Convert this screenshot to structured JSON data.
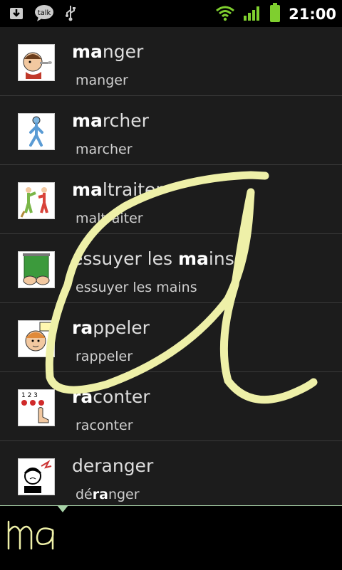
{
  "status_bar": {
    "time": "21:00",
    "talk_label": "talk",
    "icons": [
      "download-icon",
      "talk-icon",
      "usb-icon",
      "wifi-icon",
      "signal-icon",
      "battery-icon"
    ],
    "accent": "#7fcf2f"
  },
  "query": {
    "typed": "ma"
  },
  "list": {
    "items": [
      {
        "title_hl": "ma",
        "title_rest": "nger",
        "title_pre": "",
        "sub_pre": "manger",
        "sub_hl": "",
        "sub_post": "",
        "picto": "eating-icon"
      },
      {
        "title_hl": "ma",
        "title_rest": "rcher",
        "title_pre": "",
        "sub_pre": "marcher",
        "sub_hl": "",
        "sub_post": "",
        "picto": "walking-icon"
      },
      {
        "title_hl": "ma",
        "title_rest": "ltraiter",
        "title_pre": "",
        "sub_pre": "maltraiter",
        "sub_hl": "",
        "sub_post": "",
        "picto": "mistreat-icon"
      },
      {
        "title_pre": "essuyer les ",
        "title_hl": "ma",
        "title_rest": "ins",
        "sub_pre": "essuyer les mains",
        "sub_hl": "",
        "sub_post": "",
        "picto": "wipe-hands-icon"
      },
      {
        "title_hl": "ra",
        "title_rest": "ppeler",
        "title_pre": "",
        "sub_pre": "rappeler",
        "sub_hl": "",
        "sub_post": "",
        "picto": "remember-icon"
      },
      {
        "title_hl": "ra",
        "title_rest": "conter",
        "title_pre": "",
        "sub_pre": "raconter",
        "sub_hl": "",
        "sub_post": "",
        "picto": "counting-icon"
      },
      {
        "title_pre": "deranger",
        "title_hl": "",
        "title_rest": "",
        "sub_pre": "dé",
        "sub_hl": "ra",
        "sub_post": "nger",
        "picto": "disturb-icon"
      }
    ]
  },
  "colors": {
    "stroke": "#eef0a8",
    "divider": "#3b3b3b",
    "pad_border": "#9ec49e"
  }
}
